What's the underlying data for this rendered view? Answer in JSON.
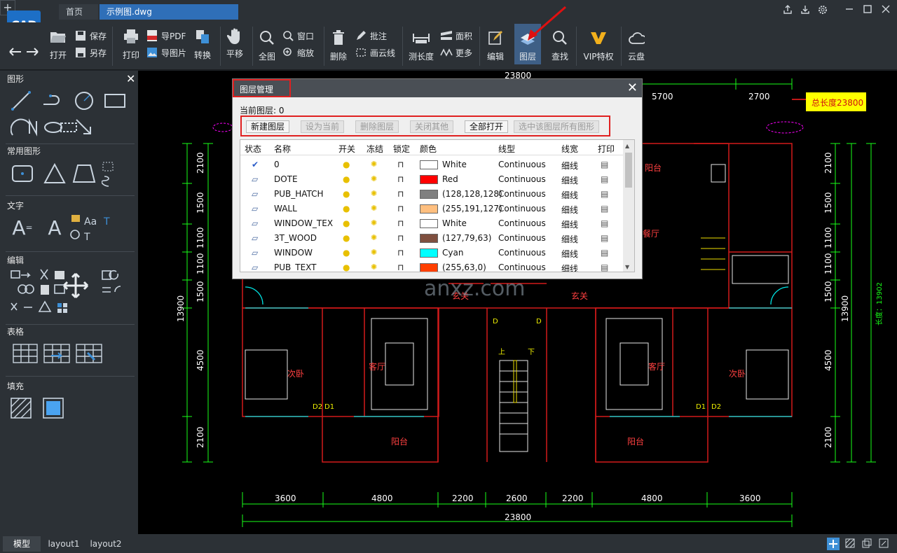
{
  "window": {
    "tabs": [
      {
        "label": "首页"
      },
      {
        "label": "示例图.dwg"
      }
    ],
    "add_tab": "+"
  },
  "toolbar": {
    "open": "打开",
    "save": "保存",
    "saveas": "另存",
    "print": "打印",
    "export_pdf": "导PDF",
    "export_img": "导图片",
    "convert": "转换",
    "pan": "平移",
    "full": "全图",
    "window": "窗口",
    "zoom": "缩放",
    "delete": "删除",
    "annotate": "批注",
    "cloud_line": "画云线",
    "measure": "测长度",
    "area": "面积",
    "more": "更多",
    "edit": "编辑",
    "layers": "图层",
    "find": "查找",
    "vip": "VIP特权",
    "cloud": "云盘"
  },
  "leftpanel": {
    "sections": [
      {
        "title": "图形"
      },
      {
        "title": "常用图形"
      },
      {
        "title": "文字"
      },
      {
        "title": "编辑"
      },
      {
        "title": "表格"
      },
      {
        "title": "填充"
      }
    ]
  },
  "dialog": {
    "title": "图层管理",
    "current_layer": "当前图层: 0",
    "buttons": [
      "新建图层",
      "设为当前",
      "删除图层",
      "关闭其他",
      "全部打开",
      "选中该图层所有图形"
    ],
    "columns": [
      "状态",
      "名称",
      "开关",
      "冻结",
      "锁定",
      "颜色",
      "线型",
      "线宽",
      "打印"
    ],
    "rows": [
      {
        "name": "0",
        "color_name": "White",
        "swatch": "#ffffff",
        "linetype": "Continuous",
        "lineweight": "细线",
        "current": true
      },
      {
        "name": "DOTE",
        "color_name": "Red",
        "swatch": "#ff0000",
        "linetype": "Continuous",
        "lineweight": "细线",
        "current": false
      },
      {
        "name": "PUB_HATCH",
        "color_name": "(128,128,128)",
        "swatch": "#808080",
        "linetype": "Continuous",
        "lineweight": "细线",
        "current": false
      },
      {
        "name": "WALL",
        "color_name": "(255,191,127)",
        "swatch": "#ffbf7f",
        "linetype": "Continuous",
        "lineweight": "细线",
        "current": false
      },
      {
        "name": "WINDOW_TEX",
        "color_name": "White",
        "swatch": "#ffffff",
        "linetype": "Continuous",
        "lineweight": "细线",
        "current": false
      },
      {
        "name": "3T_WOOD",
        "color_name": "(127,79,63)",
        "swatch": "#7f4f3f",
        "linetype": "Continuous",
        "lineweight": "细线",
        "current": false
      },
      {
        "name": "WINDOW",
        "color_name": "Cyan",
        "swatch": "#00ffff",
        "linetype": "Continuous",
        "lineweight": "细线",
        "current": false
      },
      {
        "name": "PUB_TEXT",
        "color_name": "(255,63,0)",
        "swatch": "#ff3f00",
        "linetype": "Continuous",
        "lineweight": "细线",
        "current": false
      }
    ]
  },
  "drawing": {
    "callout": "总长度23800",
    "top_dims": [
      "23800",
      "5700",
      "2700"
    ],
    "bottom_dims": [
      "3600",
      "4800",
      "2200",
      "2600",
      "2200",
      "4800",
      "3600"
    ],
    "bottom_total": "23800",
    "left_dims": [
      "2100",
      "1500",
      "1100",
      "1100",
      "1500",
      "4500",
      "2100"
    ],
    "left_total": "13900",
    "right_dims": [
      "2100",
      "1500",
      "1100",
      "1100",
      "1500",
      "4500",
      "2100"
    ],
    "right_total": "13900",
    "right_total_label": "长度：13902",
    "rooms": {
      "balcony_top": "阳台",
      "dining": "餐厅",
      "foyer_left": "玄关",
      "foyer_right": "玄关",
      "bed_left": "次卧",
      "living_left": "客厅",
      "living_right": "客厅",
      "bed_right": "次卧",
      "balcony_bl": "阳台",
      "balcony_br": "阳台"
    },
    "door_tags": [
      "D2",
      "D1",
      "D1",
      "D2",
      "D",
      "D"
    ],
    "stair_up": "上",
    "stair_down": "下",
    "watermark": "anxz.com"
  },
  "bottom": {
    "tabs": [
      "模型",
      "layout1",
      "layout2"
    ]
  }
}
